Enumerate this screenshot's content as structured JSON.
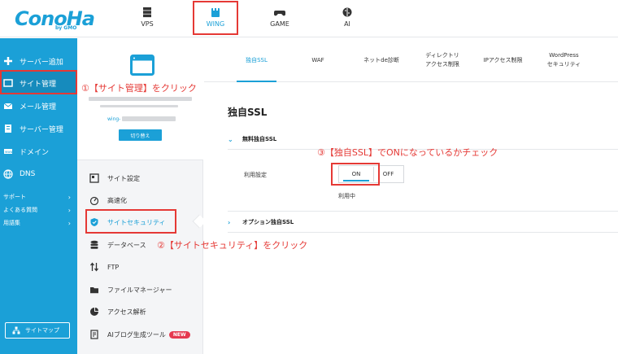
{
  "brand": {
    "logo_text": "ConoHa",
    "logo_sub": "by GMO"
  },
  "top_nav": [
    {
      "label": "VPS",
      "icon": "server-icon"
    },
    {
      "label": "WING",
      "icon": "wing-icon",
      "active": true
    },
    {
      "label": "GAME",
      "icon": "gamepad-icon"
    },
    {
      "label": "AI",
      "icon": "brain-icon"
    }
  ],
  "left_nav": {
    "items": [
      {
        "label": "サーバー追加",
        "icon": "plus-icon"
      },
      {
        "label": "サイト管理",
        "icon": "site-icon",
        "active": true
      },
      {
        "label": "メール管理",
        "icon": "mail-icon"
      },
      {
        "label": "サーバー管理",
        "icon": "server-icon"
      },
      {
        "label": "ドメイン",
        "icon": "domain-icon"
      },
      {
        "label": "DNS",
        "icon": "globe-icon"
      }
    ],
    "small_items": [
      {
        "label": "サポート"
      },
      {
        "label": "よくある質問"
      },
      {
        "label": "用語集"
      }
    ],
    "sitemap_label": "サイトマップ"
  },
  "site_panel": {
    "domain_prefix": "wing-",
    "switch_label": "切り替え",
    "menu": [
      {
        "label": "サイト設定",
        "icon": "site-settings-icon"
      },
      {
        "label": "高速化",
        "icon": "speed-icon"
      },
      {
        "label": "サイトセキュリティ",
        "icon": "shield-icon",
        "active": true
      },
      {
        "label": "データベース",
        "icon": "database-icon"
      },
      {
        "label": "FTP",
        "icon": "transfer-icon"
      },
      {
        "label": "ファイルマネージャー",
        "icon": "folder-icon"
      },
      {
        "label": "アクセス解析",
        "icon": "pie-chart-icon"
      },
      {
        "label": "AIブログ生成ツール",
        "icon": "document-icon",
        "badge": "NEW"
      }
    ]
  },
  "tabs": [
    {
      "label": "独自SSL",
      "active": true
    },
    {
      "label": "WAF"
    },
    {
      "label": "ネットde診断"
    },
    {
      "label": "ディレクトリ\nアクセス制限"
    },
    {
      "label": "IPアクセス制限"
    },
    {
      "label": "WordPress\nセキュリティ"
    }
  ],
  "content": {
    "title": "独自SSL",
    "free_ssl_heading": "無料独自SSL",
    "setting_label": "利用設定",
    "toggle_on": "ON",
    "toggle_off": "OFF",
    "status": "利用中",
    "optional_ssl_heading": "オプション独自SSL"
  },
  "annotations": {
    "step1": "①【サイト管理】をクリック",
    "step2": "②【サイトセキュリティ】をクリック",
    "step3": "③【独自SSL】でONになっているかチェック"
  },
  "colors": {
    "brand_blue": "#1ba0d7",
    "annotation_red": "#e53935",
    "new_badge": "#e53950"
  }
}
